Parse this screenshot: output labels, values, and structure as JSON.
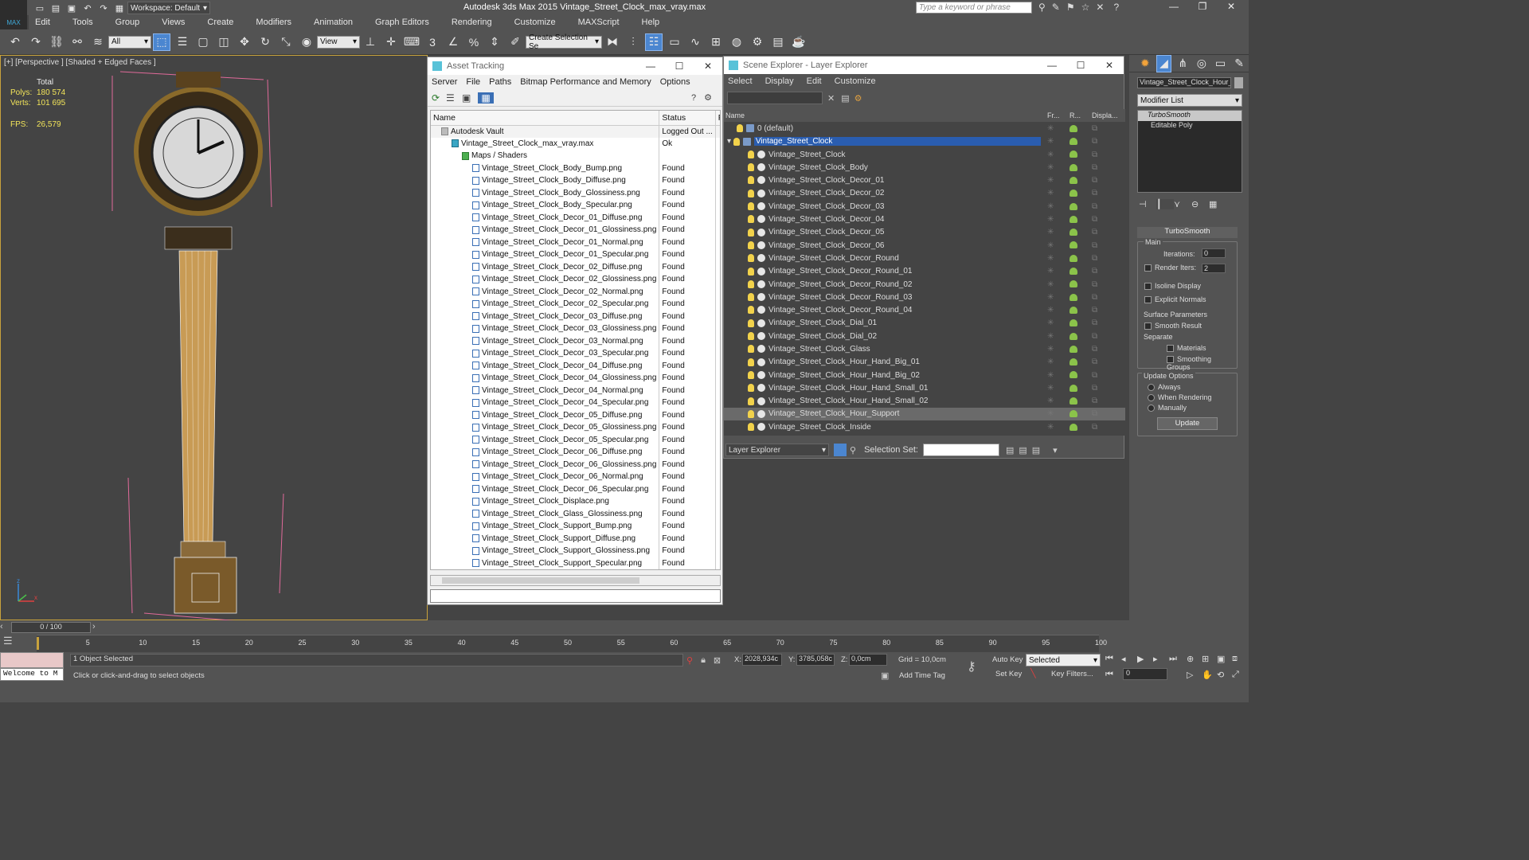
{
  "window": {
    "title": "Autodesk 3ds Max  2015     Vintage_Street_Clock_max_vray.max",
    "workspace": "Workspace: Default",
    "search_placeholder": "Type a keyword or phrase",
    "app_badge": "MAX"
  },
  "menu": [
    "Edit",
    "Tools",
    "Group",
    "Views",
    "Create",
    "Modifiers",
    "Animation",
    "Graph Editors",
    "Rendering",
    "Customize",
    "MAXScript",
    "Help"
  ],
  "toolbar": {
    "filter": "All",
    "ref_coord": "View",
    "selection_set": "Create Selection Se"
  },
  "viewport": {
    "label": "[+] [Perspective ] [Shaded + Edged Faces ]",
    "stats_total": "Total",
    "polys_label": "Polys:",
    "polys": "180 574",
    "verts_label": "Verts:",
    "verts": "101 695",
    "fps_label": "FPS:",
    "fps": "26,579"
  },
  "asset_tracking": {
    "title": "Asset Tracking",
    "menu": [
      "Server",
      "File",
      "Paths",
      "Bitmap Performance and Memory",
      "Options"
    ],
    "col_name": "Name",
    "col_status": "Status",
    "col_pr": "Pr",
    "rows": [
      {
        "name": "Autodesk Vault",
        "status": "Logged Out ...",
        "indent": 1
      },
      {
        "name": "Vintage_Street_Clock_max_vray.max",
        "status": "Ok",
        "indent": 2
      },
      {
        "name": "Maps / Shaders",
        "status": "",
        "indent": 3
      },
      {
        "name": "Vintage_Street_Clock_Body_Bump.png",
        "status": "Found",
        "indent": 4
      },
      {
        "name": "Vintage_Street_Clock_Body_Diffuse.png",
        "status": "Found",
        "indent": 4
      },
      {
        "name": "Vintage_Street_Clock_Body_Glossiness.png",
        "status": "Found",
        "indent": 4
      },
      {
        "name": "Vintage_Street_Clock_Body_Specular.png",
        "status": "Found",
        "indent": 4
      },
      {
        "name": "Vintage_Street_Clock_Decor_01_Diffuse.png",
        "status": "Found",
        "indent": 4
      },
      {
        "name": "Vintage_Street_Clock_Decor_01_Glossiness.png",
        "status": "Found",
        "indent": 4
      },
      {
        "name": "Vintage_Street_Clock_Decor_01_Normal.png",
        "status": "Found",
        "indent": 4
      },
      {
        "name": "Vintage_Street_Clock_Decor_01_Specular.png",
        "status": "Found",
        "indent": 4
      },
      {
        "name": "Vintage_Street_Clock_Decor_02_Diffuse.png",
        "status": "Found",
        "indent": 4
      },
      {
        "name": "Vintage_Street_Clock_Decor_02_Glossiness.png",
        "status": "Found",
        "indent": 4
      },
      {
        "name": "Vintage_Street_Clock_Decor_02_Normal.png",
        "status": "Found",
        "indent": 4
      },
      {
        "name": "Vintage_Street_Clock_Decor_02_Specular.png",
        "status": "Found",
        "indent": 4
      },
      {
        "name": "Vintage_Street_Clock_Decor_03_Diffuse.png",
        "status": "Found",
        "indent": 4
      },
      {
        "name": "Vintage_Street_Clock_Decor_03_Glossiness.png",
        "status": "Found",
        "indent": 4
      },
      {
        "name": "Vintage_Street_Clock_Decor_03_Normal.png",
        "status": "Found",
        "indent": 4
      },
      {
        "name": "Vintage_Street_Clock_Decor_03_Specular.png",
        "status": "Found",
        "indent": 4
      },
      {
        "name": "Vintage_Street_Clock_Decor_04_Diffuse.png",
        "status": "Found",
        "indent": 4
      },
      {
        "name": "Vintage_Street_Clock_Decor_04_Glossiness.png",
        "status": "Found",
        "indent": 4
      },
      {
        "name": "Vintage_Street_Clock_Decor_04_Normal.png",
        "status": "Found",
        "indent": 4
      },
      {
        "name": "Vintage_Street_Clock_Decor_04_Specular.png",
        "status": "Found",
        "indent": 4
      },
      {
        "name": "Vintage_Street_Clock_Decor_05_Diffuse.png",
        "status": "Found",
        "indent": 4
      },
      {
        "name": "Vintage_Street_Clock_Decor_05_Glossiness.png",
        "status": "Found",
        "indent": 4
      },
      {
        "name": "Vintage_Street_Clock_Decor_05_Specular.png",
        "status": "Found",
        "indent": 4
      },
      {
        "name": "Vintage_Street_Clock_Decor_06_Diffuse.png",
        "status": "Found",
        "indent": 4
      },
      {
        "name": "Vintage_Street_Clock_Decor_06_Glossiness.png",
        "status": "Found",
        "indent": 4
      },
      {
        "name": "Vintage_Street_Clock_Decor_06_Normal.png",
        "status": "Found",
        "indent": 4
      },
      {
        "name": "Vintage_Street_Clock_Decor_06_Specular.png",
        "status": "Found",
        "indent": 4
      },
      {
        "name": "Vintage_Street_Clock_Displace.png",
        "status": "Found",
        "indent": 4
      },
      {
        "name": "Vintage_Street_Clock_Glass_Glossiness.png",
        "status": "Found",
        "indent": 4
      },
      {
        "name": "Vintage_Street_Clock_Support_Bump.png",
        "status": "Found",
        "indent": 4
      },
      {
        "name": "Vintage_Street_Clock_Support_Diffuse.png",
        "status": "Found",
        "indent": 4
      },
      {
        "name": "Vintage_Street_Clock_Support_Glossiness.png",
        "status": "Found",
        "indent": 4
      },
      {
        "name": "Vintage_Street_Clock_Support_Specular.png",
        "status": "Found",
        "indent": 4
      }
    ]
  },
  "scene_explorer": {
    "title": "Scene Explorer - Layer Explorer",
    "menu": [
      "Select",
      "Display",
      "Edit",
      "Customize"
    ],
    "col_name": "Name",
    "col_fr": "Fr...",
    "col_r": "R...",
    "col_disp": "Displa...",
    "rows": [
      {
        "name": "0 (default)",
        "level": 0,
        "selected": false,
        "highlight": false
      },
      {
        "name": "Vintage_Street_Clock",
        "level": 0,
        "selected": true,
        "highlight": false
      },
      {
        "name": "Vintage_Street_Clock",
        "level": 1,
        "selected": false,
        "highlight": false
      },
      {
        "name": "Vintage_Street_Clock_Body",
        "level": 1,
        "selected": false,
        "highlight": false
      },
      {
        "name": "Vintage_Street_Clock_Decor_01",
        "level": 1,
        "selected": false,
        "highlight": false
      },
      {
        "name": "Vintage_Street_Clock_Decor_02",
        "level": 1,
        "selected": false,
        "highlight": false
      },
      {
        "name": "Vintage_Street_Clock_Decor_03",
        "level": 1,
        "selected": false,
        "highlight": false
      },
      {
        "name": "Vintage_Street_Clock_Decor_04",
        "level": 1,
        "selected": false,
        "highlight": false
      },
      {
        "name": "Vintage_Street_Clock_Decor_05",
        "level": 1,
        "selected": false,
        "highlight": false
      },
      {
        "name": "Vintage_Street_Clock_Decor_06",
        "level": 1,
        "selected": false,
        "highlight": false
      },
      {
        "name": "Vintage_Street_Clock_Decor_Round",
        "level": 1,
        "selected": false,
        "highlight": false
      },
      {
        "name": "Vintage_Street_Clock_Decor_Round_01",
        "level": 1,
        "selected": false,
        "highlight": false
      },
      {
        "name": "Vintage_Street_Clock_Decor_Round_02",
        "level": 1,
        "selected": false,
        "highlight": false
      },
      {
        "name": "Vintage_Street_Clock_Decor_Round_03",
        "level": 1,
        "selected": false,
        "highlight": false
      },
      {
        "name": "Vintage_Street_Clock_Decor_Round_04",
        "level": 1,
        "selected": false,
        "highlight": false
      },
      {
        "name": "Vintage_Street_Clock_Dial_01",
        "level": 1,
        "selected": false,
        "highlight": false
      },
      {
        "name": "Vintage_Street_Clock_Dial_02",
        "level": 1,
        "selected": false,
        "highlight": false
      },
      {
        "name": "Vintage_Street_Clock_Glass",
        "level": 1,
        "selected": false,
        "highlight": false
      },
      {
        "name": "Vintage_Street_Clock_Hour_Hand_Big_01",
        "level": 1,
        "selected": false,
        "highlight": false
      },
      {
        "name": "Vintage_Street_Clock_Hour_Hand_Big_02",
        "level": 1,
        "selected": false,
        "highlight": false
      },
      {
        "name": "Vintage_Street_Clock_Hour_Hand_Small_01",
        "level": 1,
        "selected": false,
        "highlight": false
      },
      {
        "name": "Vintage_Street_Clock_Hour_Hand_Small_02",
        "level": 1,
        "selected": false,
        "highlight": false
      },
      {
        "name": "Vintage_Street_Clock_Hour_Support",
        "level": 1,
        "selected": false,
        "highlight": true
      },
      {
        "name": "Vintage_Street_Clock_Inside",
        "level": 1,
        "selected": false,
        "highlight": false
      }
    ],
    "footer_mode": "Layer Explorer",
    "selection_set_label": "Selection Set:"
  },
  "command_panel": {
    "object_name": "Vintage_Street_Clock_Hour_S",
    "modifier_list": "Modifier List",
    "stack": [
      "TurboSmooth",
      "Editable Poly"
    ],
    "rollout": "TurboSmooth",
    "main_label": "Main",
    "iterations_label": "Iterations:",
    "iterations": "0",
    "render_iters_label": "Render Iters:",
    "render_iters": "2",
    "isoline": "Isoline Display",
    "explicit": "Explicit Normals",
    "surface_label": "Surface Parameters",
    "smooth_result": "Smooth Result",
    "separate_label": "Separate",
    "materials": "Materials",
    "smoothing_groups": "Smoothing Groups",
    "update_options": "Update Options",
    "always": "Always",
    "when_rendering": "When Rendering",
    "manually": "Manually",
    "update_button": "Update"
  },
  "timeline": {
    "frame": "0 / 100",
    "ticks": [
      "5",
      "10",
      "15",
      "20",
      "25",
      "30",
      "35",
      "40",
      "45",
      "50",
      "55",
      "60",
      "65",
      "70",
      "75",
      "80",
      "85",
      "90",
      "95",
      "100"
    ]
  },
  "status": {
    "maxscript": "Welcome to M",
    "selected": "1 Object Selected",
    "prompt": "Click or click-and-drag to select objects",
    "x_label": "X:",
    "x": "2028,934c",
    "y_label": "Y:",
    "y": "3785,058c",
    "z_label": "Z:",
    "z": "0,0cm",
    "grid": "Grid = 10,0cm",
    "auto_key": "Auto Key",
    "set_key": "Set Key",
    "key_mode": "Selected",
    "key_filters": "Key Filters...",
    "add_time_tag": "Add Time Tag",
    "frame_field": "0"
  },
  "axis": {
    "x": "x",
    "y": "y",
    "z": "z"
  }
}
